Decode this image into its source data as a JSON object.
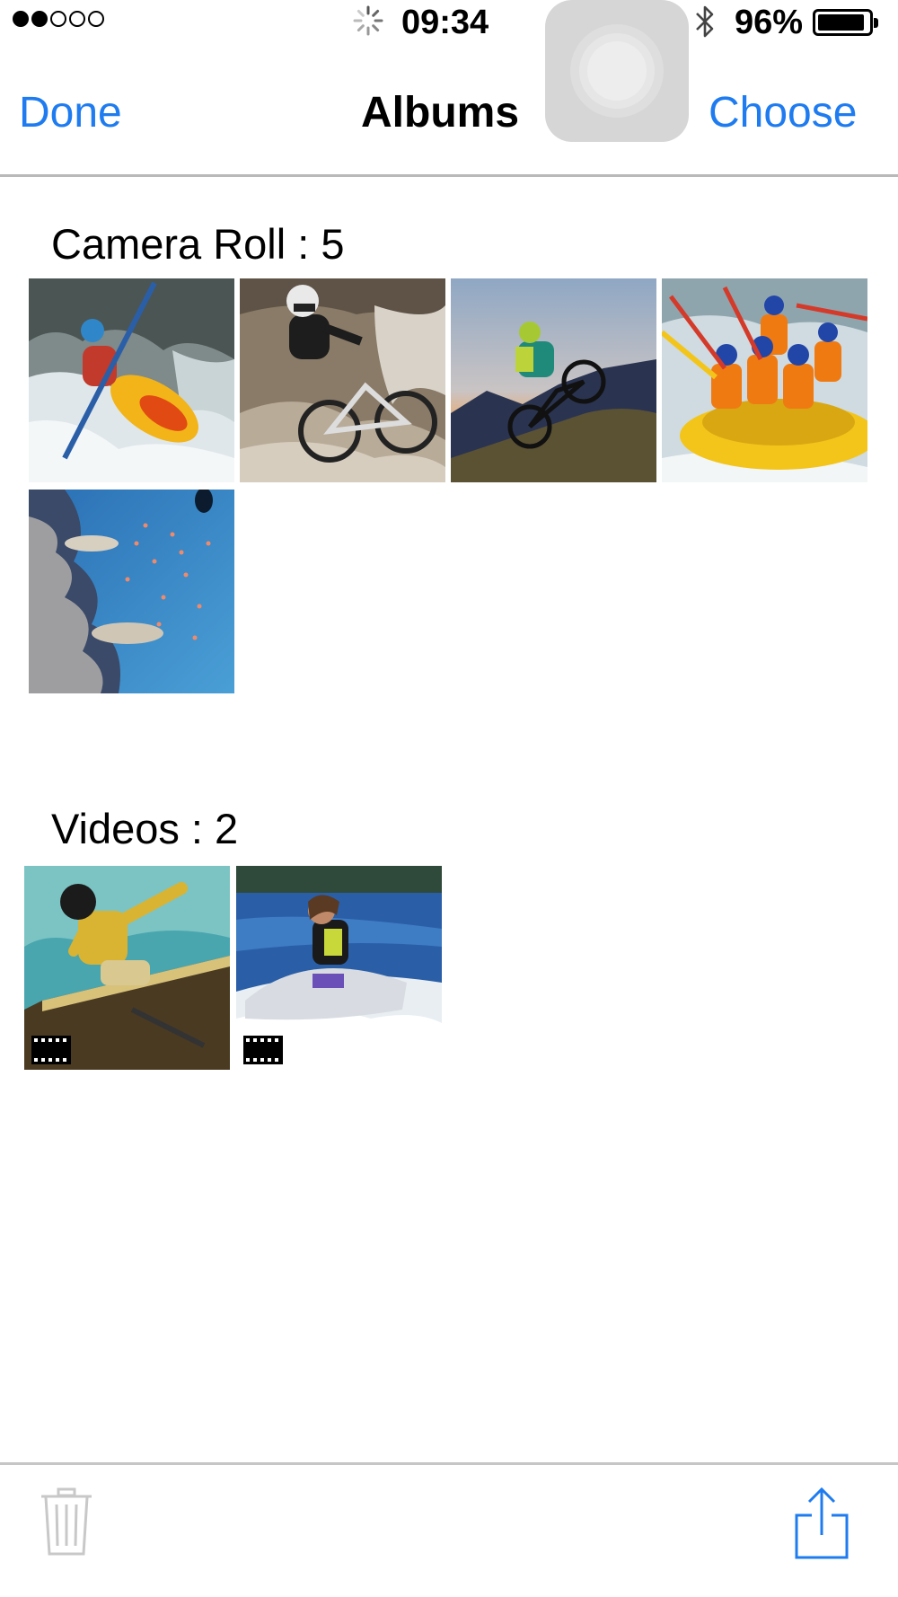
{
  "status_bar": {
    "signal": {
      "filled": 2,
      "total": 5
    },
    "time": "09:34",
    "battery_percent": "96%",
    "battery_level": 0.96,
    "icons": [
      "loading-spinner-icon",
      "bluetooth-icon",
      "battery-icon"
    ]
  },
  "nav": {
    "left_button": "Done",
    "title": "Albums",
    "right_button": "Choose"
  },
  "albums": [
    {
      "title": "Camera Roll : 5",
      "items": [
        {
          "kind": "photo",
          "subject": "kayaker in whitewater"
        },
        {
          "kind": "photo",
          "subject": "downhill mountain biker"
        },
        {
          "kind": "photo",
          "subject": "mountain biker at sunset"
        },
        {
          "kind": "photo",
          "subject": "whitewater rafting team"
        },
        {
          "kind": "photo",
          "subject": "coral reef with fish"
        }
      ]
    },
    {
      "title": "Videos : 2",
      "items": [
        {
          "kind": "video",
          "subject": "skateboarder jumping"
        },
        {
          "kind": "video",
          "subject": "jet ski rider"
        }
      ]
    }
  ],
  "toolbar": {
    "left_icon": "trash-icon",
    "right_icon": "share-icon"
  },
  "colors": {
    "accent": "#1e7cf0",
    "divider": "#b9b9b9",
    "toolbar_icon_disabled": "#c8c8c8"
  }
}
